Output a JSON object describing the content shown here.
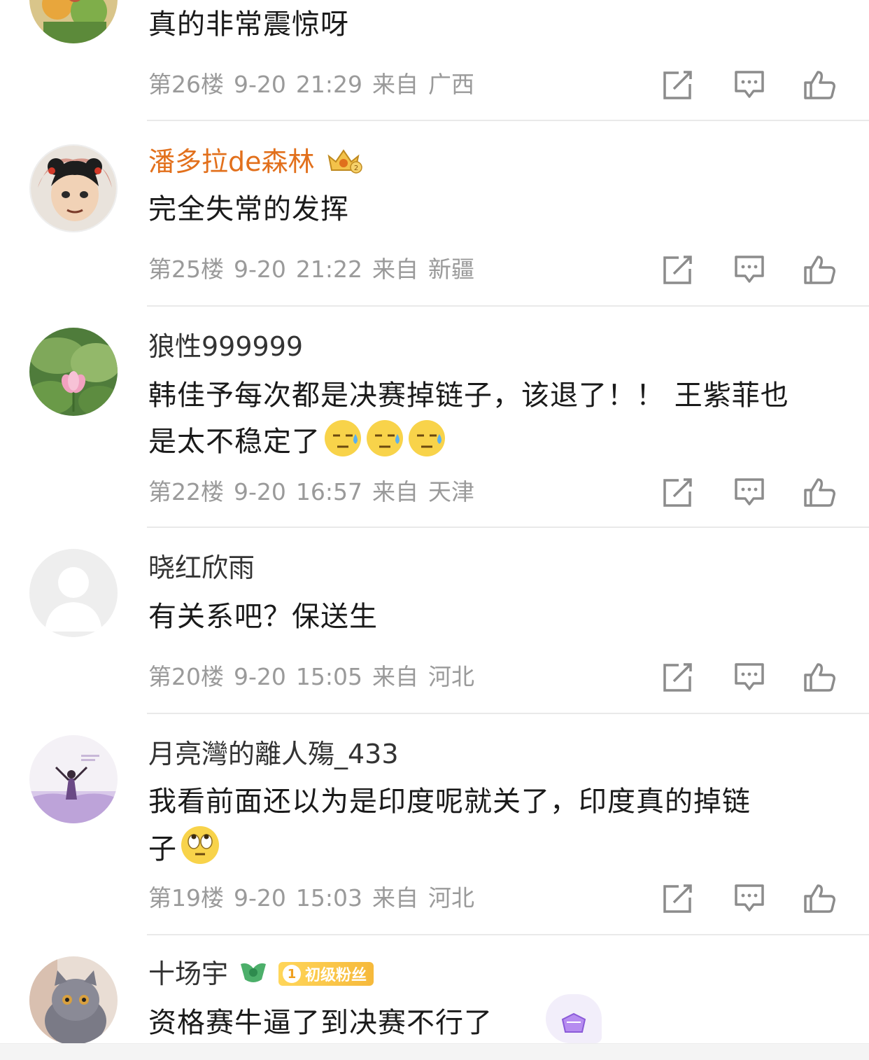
{
  "comments": [
    {
      "username": "",
      "content": "真的非常震惊呀",
      "floor": "第26楼",
      "date": "9-20",
      "time": "21:29",
      "from": "来自",
      "location": "广西"
    },
    {
      "username": "潘多拉de森林",
      "content": "完全失常的发挥",
      "floor": "第25楼",
      "date": "9-20",
      "time": "21:22",
      "from": "来自",
      "location": "新疆"
    },
    {
      "username": "狼性999999",
      "content_line1": "韩佳予每次都是决赛掉链子，该退了！！ 王紫菲也",
      "content_line2": "是太不稳定了",
      "floor": "第22楼",
      "date": "9-20",
      "time": "16:57",
      "from": "来自",
      "location": "天津"
    },
    {
      "username": "晓红欣雨",
      "content": "有关系吧？保送生",
      "floor": "第20楼",
      "date": "9-20",
      "time": "15:05",
      "from": "来自",
      "location": "河北"
    },
    {
      "username": "月亮灣的離人殤_433",
      "content_line1": "我看前面还以为是印度呢就关了，印度真的掉链",
      "content_line2": "子",
      "floor": "第19楼",
      "date": "9-20",
      "time": "15:03",
      "from": "来自",
      "location": "河北"
    },
    {
      "username": "十场宇",
      "fan_badge": "初级粉丝",
      "fan_level": "1",
      "content": "资格赛牛逼了到决赛不行了"
    }
  ],
  "icons": {
    "share": "share-icon",
    "reply": "comment-icon",
    "like": "thumbs-up-icon"
  },
  "colors": {
    "vip_name": "#e2701c",
    "meta_text": "#9a9a9a",
    "icon": "#8c8c8c",
    "fan_badge": "#f6b93b"
  }
}
